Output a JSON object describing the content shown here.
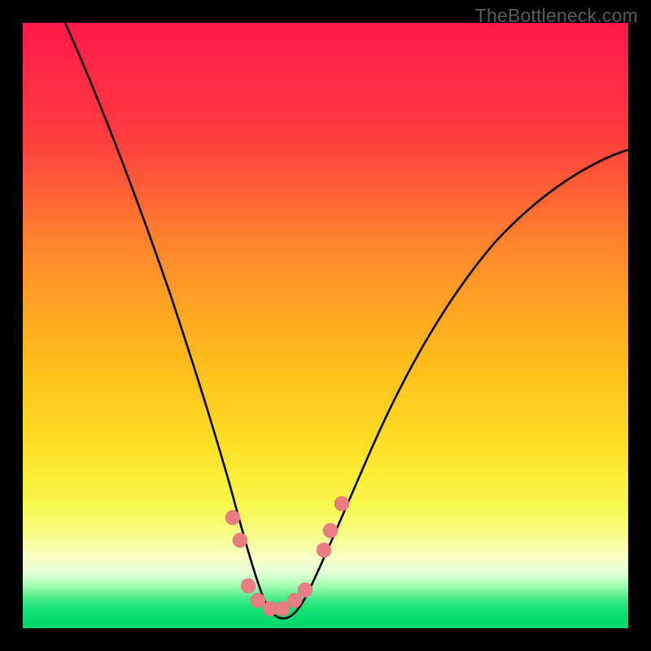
{
  "watermark": "TheBottleneck.com",
  "chart_data": {
    "type": "line",
    "title": "",
    "xlabel": "",
    "ylabel": "",
    "xlim": [
      0,
      100
    ],
    "ylim": [
      0,
      100
    ],
    "gradient_colors": {
      "top": "#ff1a4a",
      "upper_mid": "#ff8a2a",
      "mid": "#ffd400",
      "lower_mid": "#f6ff60",
      "band_light": "#f8ffb8",
      "green": "#00e571",
      "bottom_green": "#00d66a"
    },
    "series": [
      {
        "name": "bottleneck-curve",
        "stroke": "#000000",
        "x": [
          7,
          10,
          13,
          16,
          19,
          22,
          25,
          28,
          30,
          32,
          34,
          36,
          37.5,
          39,
          40.5,
          42,
          43.5,
          45,
          47,
          49,
          52,
          56,
          60,
          65,
          70,
          75,
          80,
          85,
          90,
          95,
          100
        ],
        "y": [
          100,
          92,
          84,
          76,
          68,
          60,
          52,
          44,
          38,
          32,
          26,
          20,
          15,
          10,
          6,
          3,
          1.5,
          1.5,
          3.5,
          7,
          13,
          22,
          31,
          41,
          49,
          56,
          62,
          67.5,
          72,
          76,
          79
        ]
      }
    ],
    "markers": {
      "name": "highlight-points",
      "fill": "#e87d82",
      "points": [
        {
          "x": 34.5,
          "y": 18.5
        },
        {
          "x": 35.8,
          "y": 14.5
        },
        {
          "x": 37.2,
          "y": 6.8
        },
        {
          "x": 38.8,
          "y": 4.6
        },
        {
          "x": 40.8,
          "y": 3.4
        },
        {
          "x": 42.8,
          "y": 3.4
        },
        {
          "x": 44.8,
          "y": 4.6
        },
        {
          "x": 46.6,
          "y": 6.4
        },
        {
          "x": 49.6,
          "y": 13.2
        },
        {
          "x": 50.8,
          "y": 16.5
        },
        {
          "x": 52.6,
          "y": 21.0
        }
      ]
    }
  }
}
